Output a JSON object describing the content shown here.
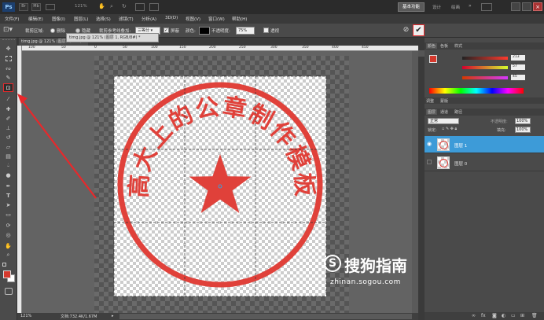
{
  "titlebar": {
    "zoom": "121%",
    "workspace": "基本功能",
    "ws_design": "设计",
    "ws_paint": "绘画",
    "ws_more": "»"
  },
  "menu": [
    "文件(F)",
    "编辑(E)",
    "图像(I)",
    "图层(L)",
    "选择(S)",
    "滤镜(T)",
    "分析(A)",
    "3D(D)",
    "视图(V)",
    "窗口(W)",
    "帮助(H)"
  ],
  "options": {
    "crop_area": "裁剪区域:",
    "delete": "删除",
    "hide": "隐藏",
    "guide_label": "裁剪参考线叠加:",
    "guide_value": "三等分",
    "shield": "屏蔽",
    "color_label": "颜色:",
    "opacity_label": "不透明度:",
    "opacity_value": "75%",
    "perspective": "透视"
  },
  "document": {
    "tab1": "timg.jpg @ 121% (图层 1, RGB/8#) *",
    "tab2": "timg.jpg @ 121% (图层 1, RGB/8#) *",
    "ruler_labels": [
      "100",
      "50",
      "0",
      "50",
      "100",
      "150",
      "200",
      "250",
      "300",
      "350",
      "400",
      "450"
    ],
    "seal_text": "高大上的公章制作模板"
  },
  "status": {
    "zoom": "121%",
    "doc": "文档:732.4K/1.67M"
  },
  "color_panel": {
    "tab_color": "颜色",
    "tab_swatches": "色板",
    "tab_styles": "样式",
    "r": "213",
    "g": "57",
    "b": "45"
  },
  "adjust_panel": {
    "tab_adjust": "调整",
    "tab_mask": "蒙版"
  },
  "layers_panel": {
    "tab_layers": "图层",
    "tab_channels": "通道",
    "tab_paths": "路径",
    "blend_mode": "正常",
    "opacity_label": "不透明度:",
    "opacity_value": "100%",
    "lock_label": "锁定:",
    "fill_label": "填充:",
    "fill_value": "100%",
    "layers": [
      "图层 1",
      "图层 0"
    ]
  },
  "watermark": {
    "brand": "搜狗指南",
    "url": "zhinan.sogou.com"
  },
  "colors": {
    "accent": "#3d9bd8",
    "seal": "#e0413a",
    "arrow": "#e8282b",
    "fg_swatch": "#d5392d"
  }
}
